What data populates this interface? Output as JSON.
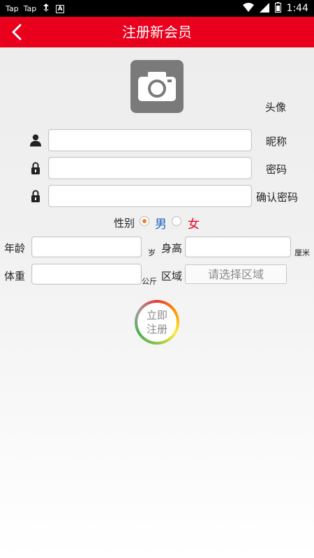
{
  "status_bar": {
    "left_items": [
      "Tap",
      "Tap"
    ],
    "time": "1:44",
    "icons": [
      "sync-icon",
      "a-box-icon",
      "wifi-icon",
      "signal-icon",
      "battery-icon"
    ]
  },
  "header": {
    "title": "注册新会员",
    "back_icon": "chevron-left-icon",
    "color": "#e8001c"
  },
  "avatar": {
    "label": "头像",
    "icon": "camera-icon"
  },
  "form": {
    "nickname": {
      "label": "昵称",
      "value": "",
      "icon": "user-icon"
    },
    "password": {
      "label": "密码",
      "value": "",
      "icon": "lock-icon"
    },
    "confirm_password": {
      "label": "确认密码",
      "value": "",
      "icon": "lock-icon"
    },
    "gender": {
      "label": "性别",
      "male": "男",
      "female": "女",
      "selected": "男"
    },
    "age": {
      "label": "年龄",
      "value": "",
      "unit": "岁"
    },
    "height": {
      "label": "身高",
      "value": "",
      "unit": "厘米"
    },
    "weight": {
      "label": "体重",
      "value": "",
      "unit": "公斤"
    },
    "region": {
      "label": "区域",
      "button": "请选择区域"
    }
  },
  "register_button": {
    "line1": "立即",
    "line2": "注册"
  }
}
